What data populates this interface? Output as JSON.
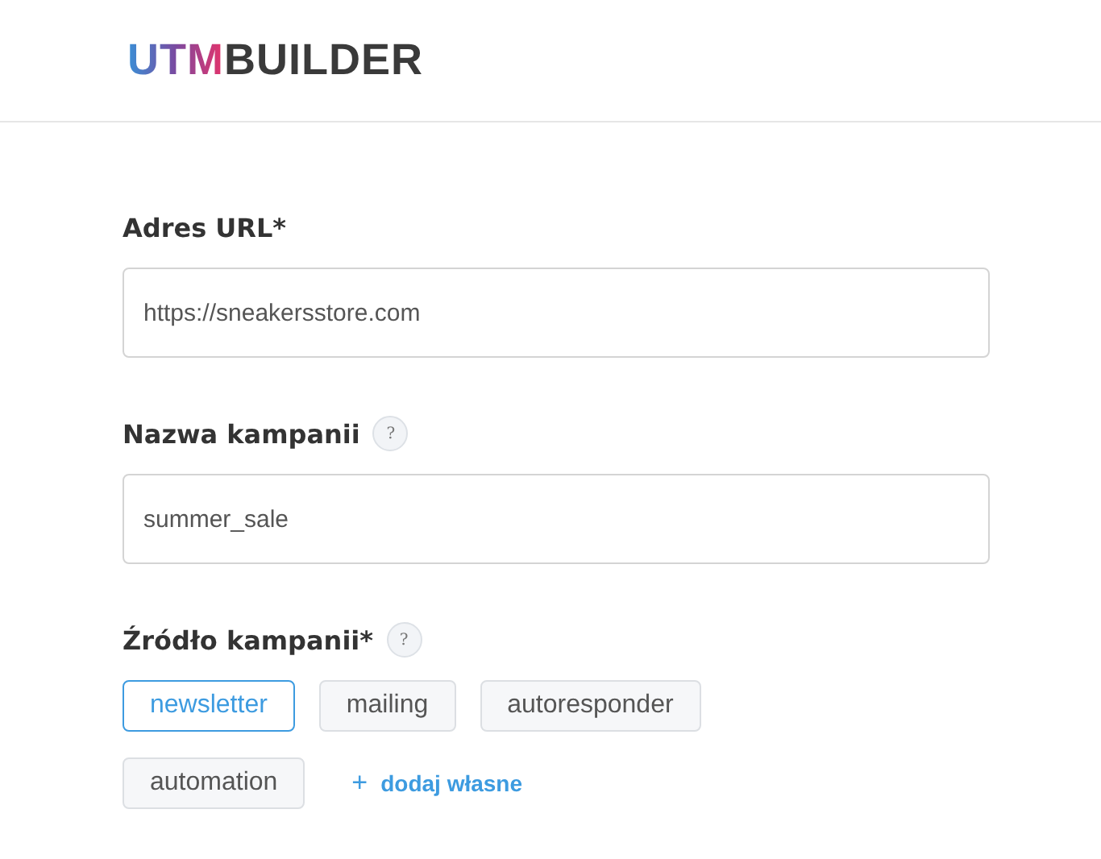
{
  "logo": {
    "accent": "UTM",
    "text": "BUILDER"
  },
  "fields": [
    {
      "kind": "input",
      "label": "Adres URL*",
      "value": "https://sneakersstore.com"
    },
    {
      "kind": "input",
      "label": "Nazwa kampanii",
      "help_text": "?",
      "value": "summer_sale"
    },
    {
      "kind": "chips",
      "label": "Źródło kampanii*",
      "help_text": "?",
      "chips": [
        {
          "label": "newsletter",
          "selected": true
        },
        {
          "label": "mailing",
          "selected": false
        },
        {
          "label": "autoresponder",
          "selected": false
        },
        {
          "label": "automation",
          "selected": false
        }
      ],
      "add_icon": "+",
      "add_label": "dodaj własne"
    }
  ]
}
